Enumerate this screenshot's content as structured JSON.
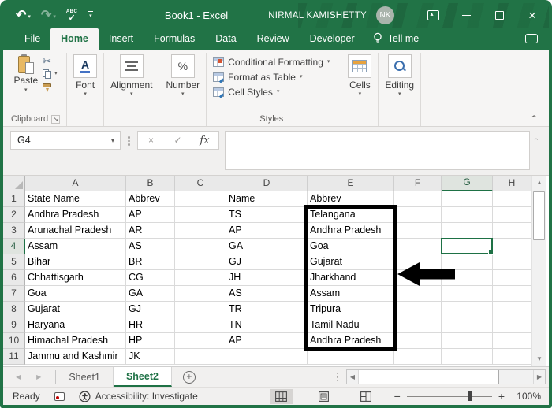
{
  "window": {
    "title": "Book1 - Excel",
    "user": "NIRMAL KAMISHETTY",
    "avatar_initials": "NK"
  },
  "tabs": {
    "items": [
      "File",
      "Home",
      "Insert",
      "Formulas",
      "Data",
      "Review",
      "Developer"
    ],
    "active": "Home",
    "tell_me": "Tell me"
  },
  "ribbon": {
    "paste": "Paste",
    "clipboard_label": "Clipboard",
    "font_label": "Font",
    "alignment_label": "Alignment",
    "number_label": "Number",
    "styles": {
      "label": "Styles",
      "conditional_formatting": "Conditional Formatting",
      "format_as_table": "Format as Table",
      "cell_styles": "Cell Styles"
    },
    "cells_label": "Cells",
    "editing_label": "Editing"
  },
  "formula_bar": {
    "name_box": "G4",
    "fx_label": "fx",
    "formula_value": ""
  },
  "grid": {
    "columns": [
      "A",
      "B",
      "C",
      "D",
      "E",
      "F",
      "G",
      "H"
    ],
    "selected_cell": "G4",
    "selected_column": "G",
    "selected_row": 4,
    "rows": [
      {
        "n": 1,
        "cells": {
          "A": "State Name",
          "B": "Abbrev",
          "D": "Name",
          "E": "Abbrev"
        }
      },
      {
        "n": 2,
        "cells": {
          "A": "Andhra Pradesh",
          "B": "AP",
          "D": "TS",
          "E": "Telangana"
        }
      },
      {
        "n": 3,
        "cells": {
          "A": "Arunachal Pradesh",
          "B": "AR",
          "D": "AP",
          "E": "Andhra Pradesh"
        }
      },
      {
        "n": 4,
        "cells": {
          "A": "Assam",
          "B": "AS",
          "D": "GA",
          "E": "Goa"
        }
      },
      {
        "n": 5,
        "cells": {
          "A": "Bihar",
          "B": "BR",
          "D": "GJ",
          "E": "Gujarat"
        }
      },
      {
        "n": 6,
        "cells": {
          "A": "Chhattisgarh",
          "B": "CG",
          "D": "JH",
          "E": "Jharkhand"
        }
      },
      {
        "n": 7,
        "cells": {
          "A": "Goa",
          "B": "GA",
          "D": "AS",
          "E": "Assam"
        }
      },
      {
        "n": 8,
        "cells": {
          "A": "Gujarat",
          "B": "GJ",
          "D": "TR",
          "E": "Tripura"
        }
      },
      {
        "n": 9,
        "cells": {
          "A": "Haryana",
          "B": "HR",
          "D": "TN",
          "E": "Tamil Nadu"
        }
      },
      {
        "n": 10,
        "cells": {
          "A": "Himachal Pradesh",
          "B": "HP",
          "D": "AP",
          "E": "Andhra Pradesh"
        }
      },
      {
        "n": 11,
        "cells": {
          "A": "Jammu and Kashmir",
          "B": "JK"
        }
      }
    ],
    "annotations": {
      "highlight_box_range": "E2:E10",
      "arrow_points_to": "E6"
    }
  },
  "sheet_bar": {
    "tabs": [
      {
        "label": "Sheet1",
        "active": false
      },
      {
        "label": "Sheet2",
        "active": true
      }
    ]
  },
  "status_bar": {
    "mode": "Ready",
    "accessibility": "Accessibility: Investigate",
    "zoom_level": "100%"
  },
  "colors": {
    "accent": "#217346",
    "selection": "#1e7145",
    "highlight_box": "#000000"
  }
}
